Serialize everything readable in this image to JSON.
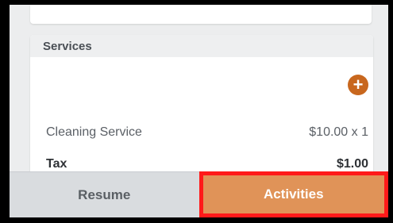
{
  "services": {
    "title": "Services",
    "add_icon": "plus-icon",
    "items": [
      {
        "name": "Cleaning Service",
        "price": "$10.00 x 1"
      }
    ],
    "tax": {
      "label": "Tax",
      "value": "$1.00"
    }
  },
  "bottom_tabs": {
    "resume_label": "Resume",
    "activities_label": "Activities"
  },
  "colors": {
    "accent": "#c8671e",
    "activities_tab": "#e09358",
    "highlight": "#ff1a1a"
  }
}
